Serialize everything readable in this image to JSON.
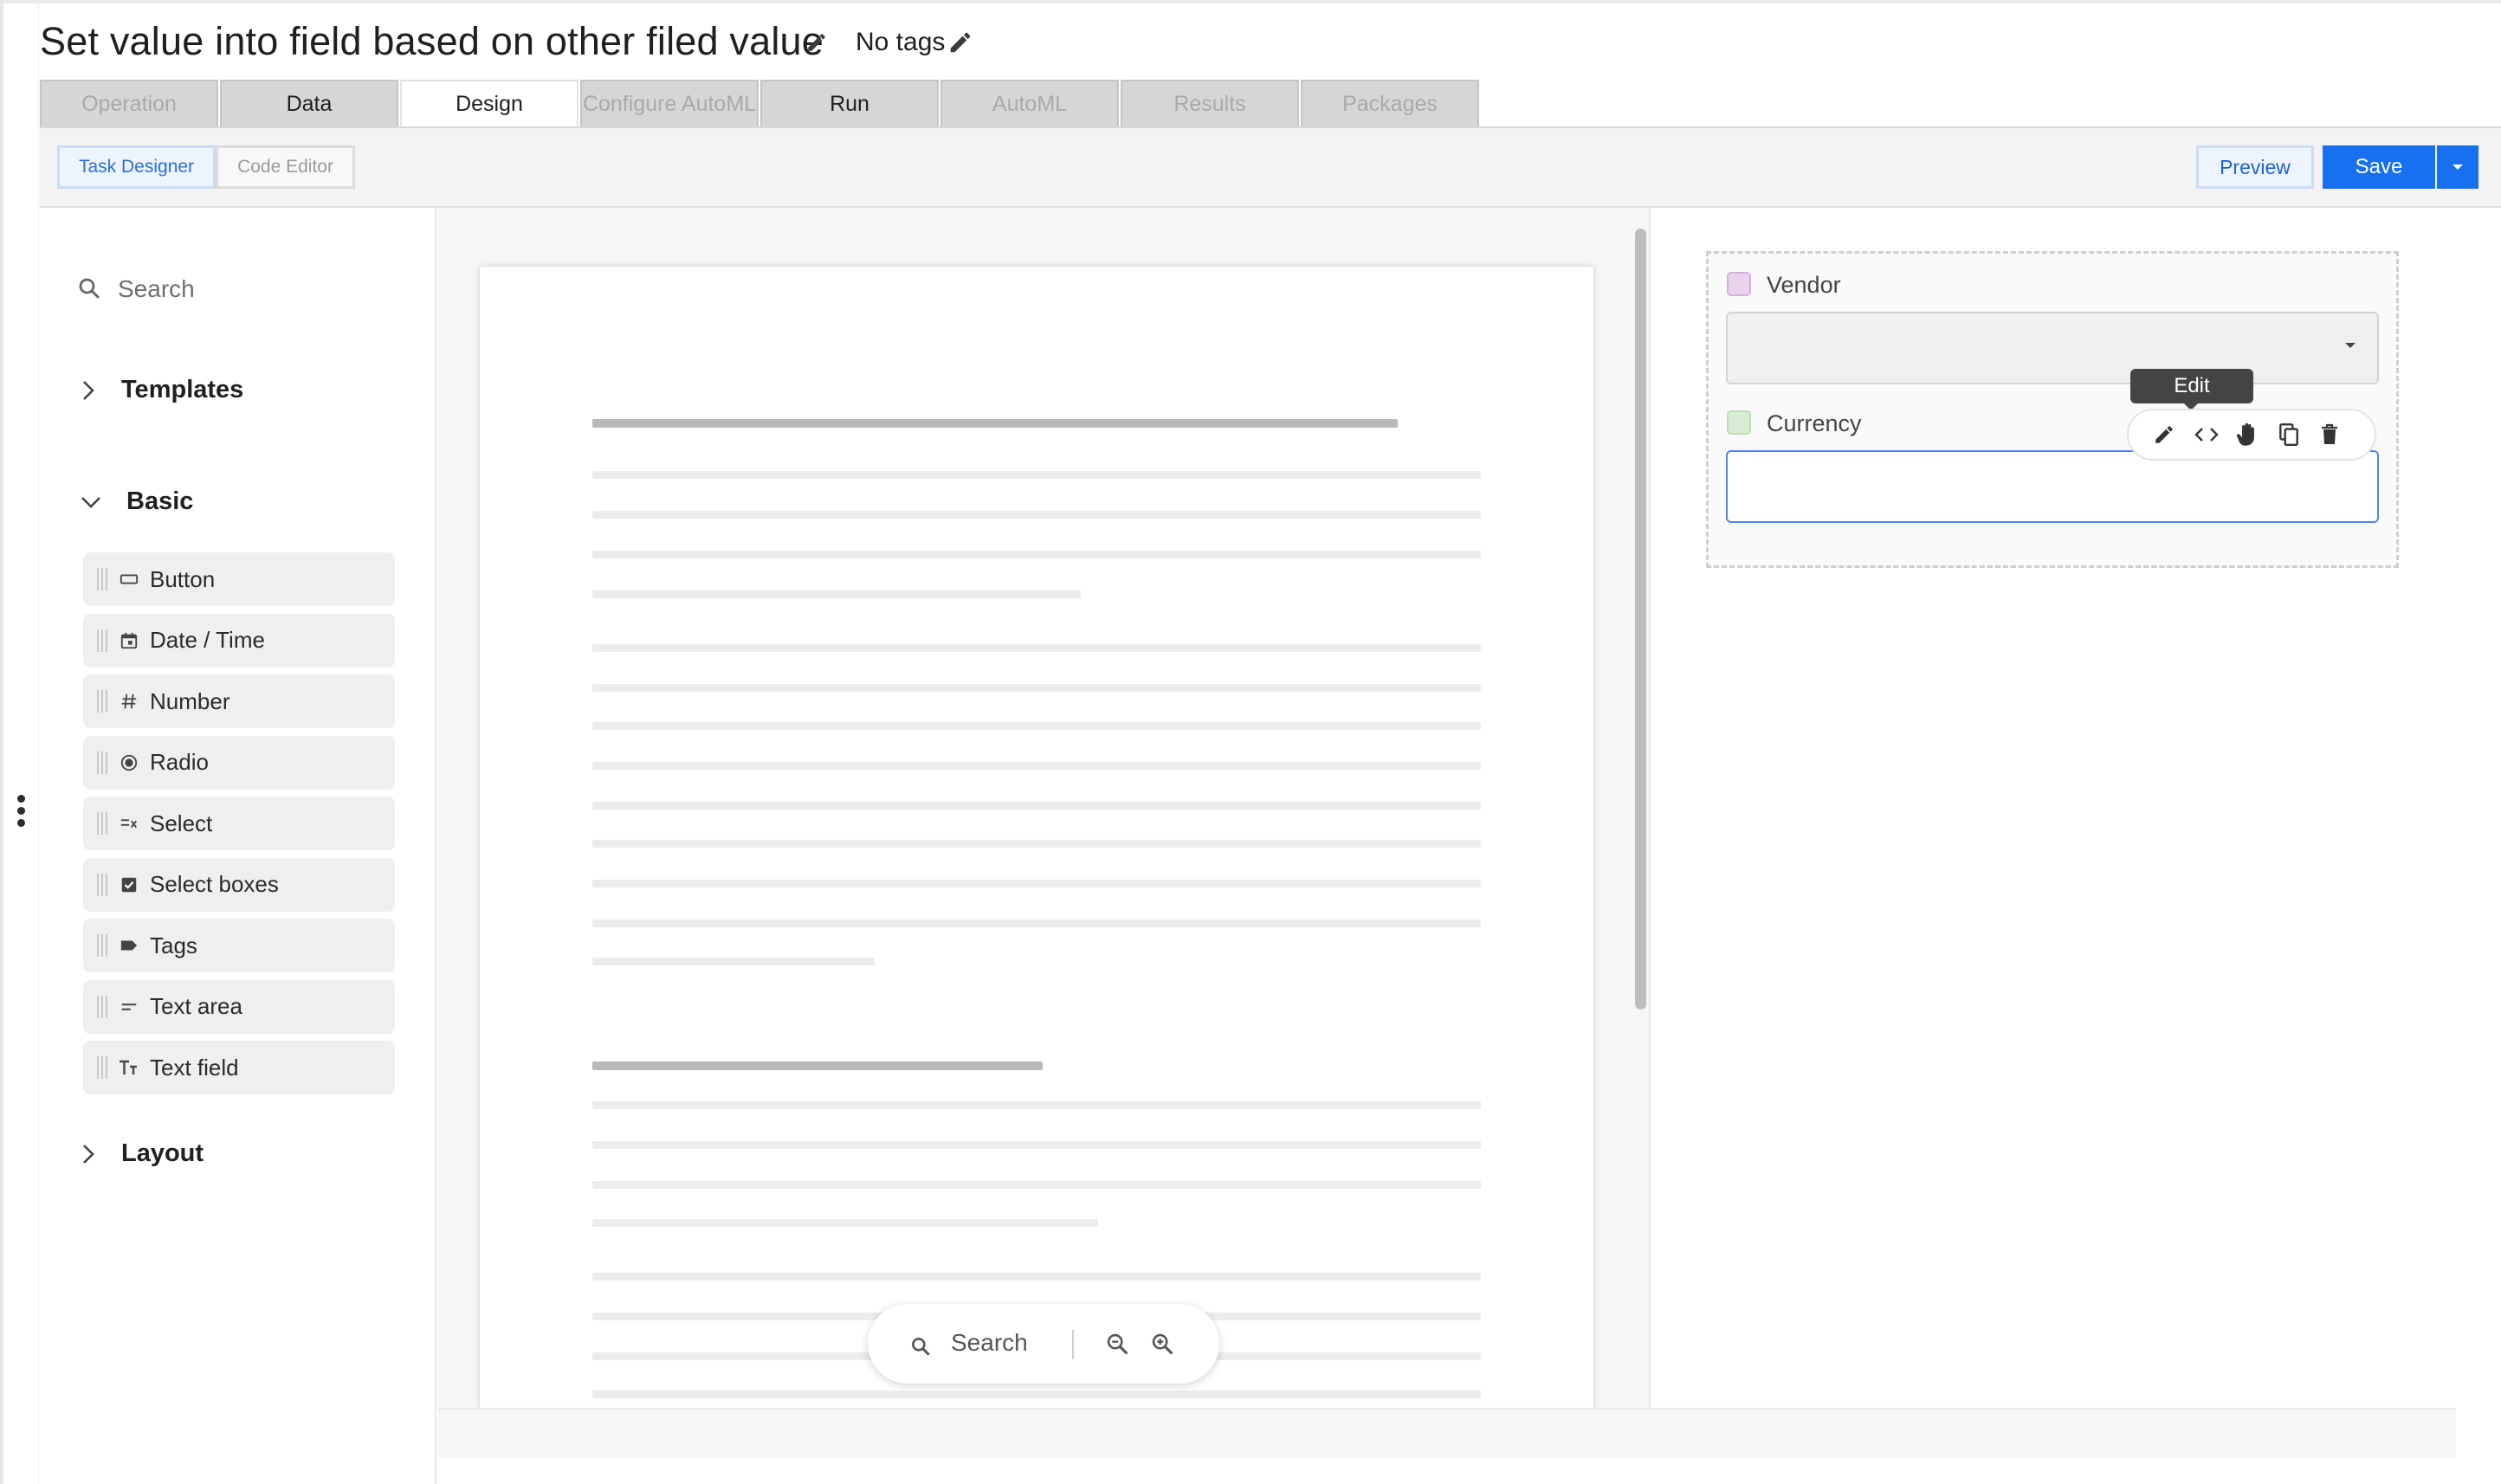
{
  "header": {
    "title": "Set value into field based on other filed value",
    "tags_label": "No tags",
    "icons": {
      "title_edit": "pencil-icon",
      "tags_edit": "pencil-icon"
    }
  },
  "tabs": [
    {
      "label": "Operation",
      "state": "disabled"
    },
    {
      "label": "Data",
      "state": "enabled"
    },
    {
      "label": "Design",
      "state": "active"
    },
    {
      "label": "Configure AutoML",
      "state": "disabled"
    },
    {
      "label": "Run",
      "state": "enabled"
    },
    {
      "label": "AutoML",
      "state": "disabled"
    },
    {
      "label": "Results",
      "state": "disabled"
    },
    {
      "label": "Packages",
      "state": "disabled"
    }
  ],
  "toolbar": {
    "mode_tabs": [
      {
        "label": "Task Designer",
        "active": true
      },
      {
        "label": "Code Editor",
        "active": false
      }
    ],
    "preview_label": "Preview",
    "save_label": "Save",
    "save_menu_icon": "caret-down-icon"
  },
  "sidebar": {
    "search_placeholder": "Search",
    "sections": {
      "templates": "Templates",
      "basic": "Basic",
      "layout": "Layout"
    },
    "components": [
      {
        "label": "Button",
        "icon": "button-icon"
      },
      {
        "label": "Date / Time",
        "icon": "calendar-icon"
      },
      {
        "label": "Number",
        "icon": "hash-icon"
      },
      {
        "label": "Radio",
        "icon": "radio-icon"
      },
      {
        "label": "Select",
        "icon": "select-list-icon"
      },
      {
        "label": "Select boxes",
        "icon": "checkbox-icon"
      },
      {
        "label": "Tags",
        "icon": "tag-icon"
      },
      {
        "label": "Text area",
        "icon": "text-area-icon"
      },
      {
        "label": "Text field",
        "icon": "text-field-icon"
      }
    ]
  },
  "canvas": {
    "search_label": "Search",
    "icons": [
      "search-icon",
      "zoom-out-icon",
      "zoom-in-icon"
    ]
  },
  "form": {
    "fields": [
      {
        "label": "Vendor",
        "type": "select",
        "value": "",
        "color": "#e9d2ec"
      },
      {
        "label": "Currency",
        "type": "text",
        "value": "",
        "color": "#d8ecd4"
      }
    ],
    "tooltip": "Edit",
    "actions": [
      "pencil-icon",
      "code-icon",
      "hand-icon",
      "copy-icon",
      "trash-icon"
    ]
  },
  "colors": {
    "accent": "#1670ef",
    "focus_border": "#4d86ee"
  }
}
